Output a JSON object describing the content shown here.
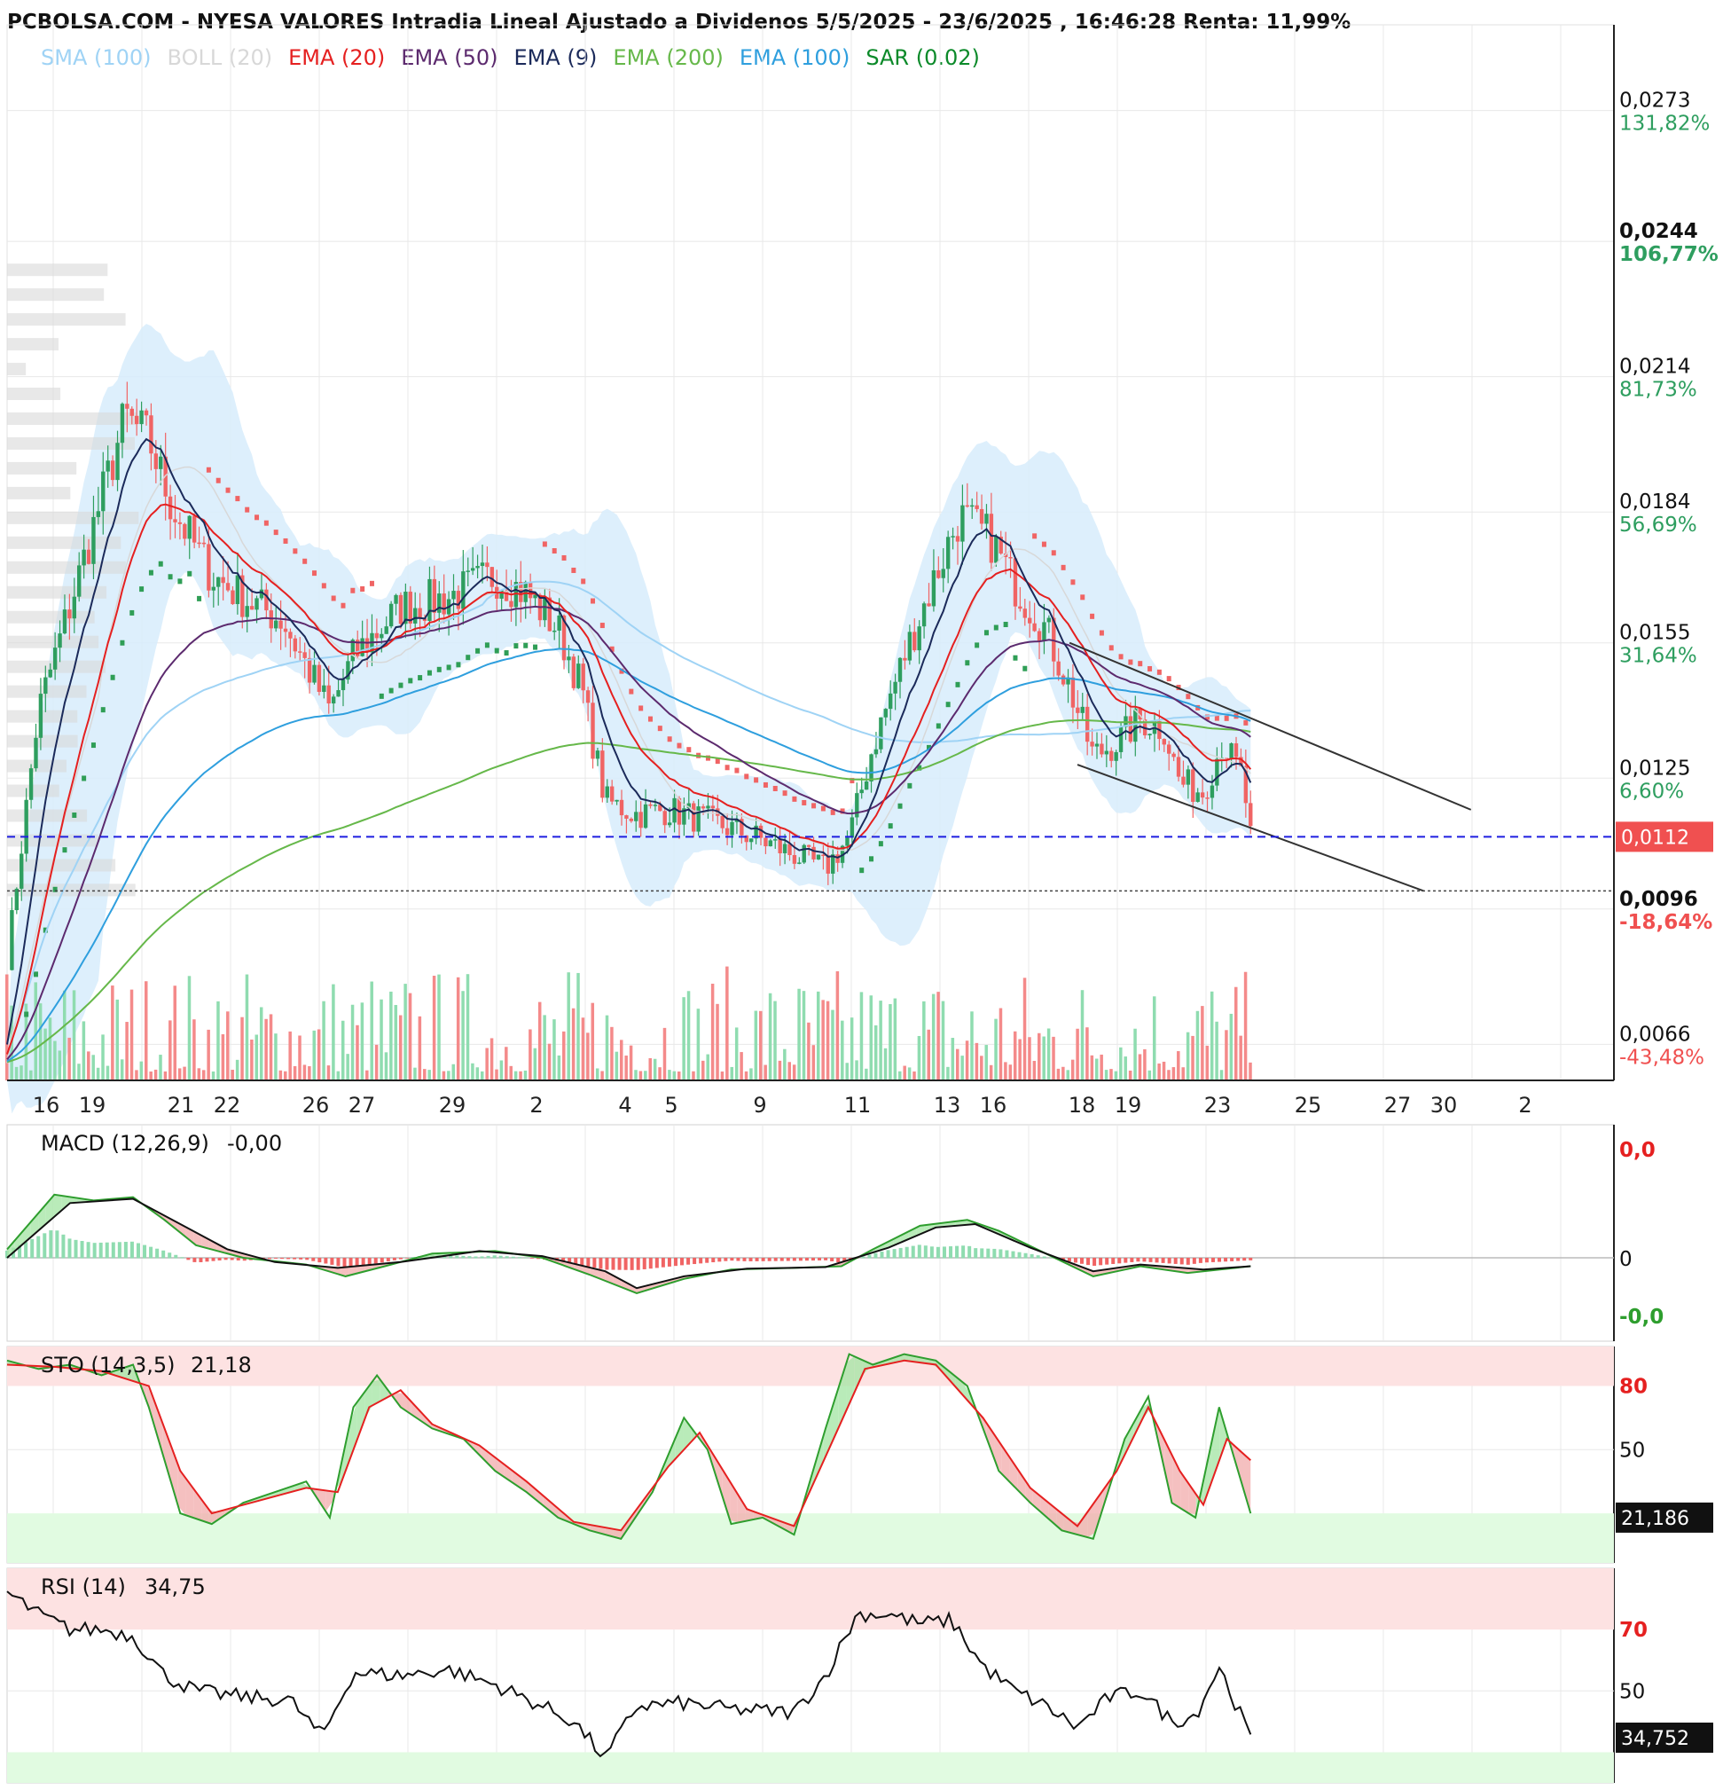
{
  "header": {
    "title": "PCBOLSA.COM - NYESA VALORES Intradia Lineal Ajustado a Dividenos 5/5/2025 - 23/6/2025 , 16:46:28 Renta: 11,99%"
  },
  "legend": [
    {
      "label": "SMA (100)",
      "color": "#9fd3f5"
    },
    {
      "label": "BOLL (20)",
      "color": "#d8d8d8"
    },
    {
      "label": "EMA (20)",
      "color": "#e52020"
    },
    {
      "label": "EMA (50)",
      "color": "#5c2a6e"
    },
    {
      "label": "EMA (9)",
      "color": "#1b2a5a"
    },
    {
      "label": "EMA (200)",
      "color": "#66b84a"
    },
    {
      "label": "EMA (100)",
      "color": "#2f9fde"
    },
    {
      "label": "SAR (0.02)",
      "color": "#0c8a2a"
    }
  ],
  "colors": {
    "up": "#2e9e5f",
    "down": "#f06464",
    "up_volume": "#8fdcb0",
    "down_volume": "#f48a8a",
    "sar_up": "#2f9e56",
    "sar_down": "#f06464",
    "band_fill": "#d7ecfb",
    "grid": "#e8e8e8",
    "price_tag": "#f05050",
    "current_line": "#1f1fe0",
    "pct_up": "#2e9e5f",
    "pct_down": "#f05050"
  },
  "chart_data": [
    {
      "type": "candlestick",
      "name": "price",
      "ylim": [
        0.0058,
        0.0292
      ],
      "current_price": "0,0112",
      "reference_price": 0.01,
      "y_ticks": [
        {
          "value": 0.0273,
          "label": "0,0273",
          "pct": "131,82%",
          "bold": false
        },
        {
          "value": 0.0244,
          "label": "0,0244",
          "pct": "106,77%",
          "bold": true
        },
        {
          "value": 0.0214,
          "label": "0,0214",
          "pct": "81,73%",
          "bold": false
        },
        {
          "value": 0.0184,
          "label": "0,0184",
          "pct": "56,69%",
          "bold": false
        },
        {
          "value": 0.0155,
          "label": "0,0155",
          "pct": "31,64%",
          "bold": false
        },
        {
          "value": 0.0125,
          "label": "0,0125",
          "pct": "6,60%",
          "bold": false
        },
        {
          "value": 0.0096,
          "label": "0,0096",
          "pct": "-18,64%",
          "bold": true
        },
        {
          "value": 0.0066,
          "label": "0,0066",
          "pct": "-43,48%",
          "bold": false
        }
      ],
      "x_labels": [
        "16",
        "19",
        "21",
        "22",
        "26",
        "27",
        "29",
        "2",
        "4",
        "5",
        "9",
        "11",
        "13",
        "16",
        "18",
        "19",
        "23",
        "25",
        "27",
        "30",
        "2"
      ],
      "trend_lines": [
        {
          "from": [
            0.675,
            0.0155
          ],
          "to": [
            0.93,
            0.0118
          ]
        },
        {
          "from": [
            0.68,
            0.0128
          ],
          "to": [
            0.9,
            0.01
          ]
        }
      ],
      "waypoints": [
        [
          0,
          0.0085
        ],
        [
          0.02,
          0.014
        ],
        [
          0.05,
          0.0175
        ],
        [
          0.075,
          0.0205
        ],
        [
          0.09,
          0.02
        ],
        [
          0.105,
          0.0185
        ],
        [
          0.13,
          0.017
        ],
        [
          0.15,
          0.0165
        ],
        [
          0.175,
          0.016
        ],
        [
          0.19,
          0.015
        ],
        [
          0.205,
          0.014
        ],
        [
          0.22,
          0.0152
        ],
        [
          0.25,
          0.0163
        ],
        [
          0.28,
          0.0165
        ],
        [
          0.31,
          0.017
        ],
        [
          0.33,
          0.0166
        ],
        [
          0.35,
          0.0158
        ],
        [
          0.365,
          0.0145
        ],
        [
          0.38,
          0.012
        ],
        [
          0.4,
          0.0117
        ],
        [
          0.42,
          0.0118
        ],
        [
          0.45,
          0.0115
        ],
        [
          0.475,
          0.0112
        ],
        [
          0.5,
          0.0108
        ],
        [
          0.52,
          0.0105
        ],
        [
          0.535,
          0.0112
        ],
        [
          0.55,
          0.0132
        ],
        [
          0.57,
          0.0152
        ],
        [
          0.59,
          0.017
        ],
        [
          0.605,
          0.0183
        ],
        [
          0.625,
          0.0178
        ],
        [
          0.64,
          0.0168
        ],
        [
          0.66,
          0.0158
        ],
        [
          0.675,
          0.0145
        ],
        [
          0.69,
          0.013
        ],
        [
          0.705,
          0.0133
        ],
        [
          0.72,
          0.0138
        ],
        [
          0.735,
          0.0136
        ],
        [
          0.745,
          0.0124
        ],
        [
          0.76,
          0.0122
        ],
        [
          0.772,
          0.0133
        ],
        [
          0.785,
          0.0125
        ],
        [
          0.79,
          0.0112
        ]
      ]
    },
    {
      "type": "line",
      "name": "MACD (12,26,9)",
      "value": "-0,00",
      "y_ticks": [
        {
          "label": "0,0",
          "color": "#e52020"
        },
        {
          "label": "0",
          "color": "#111111"
        },
        {
          "label": "-0,0",
          "color": "#2e9e2e"
        }
      ],
      "macd": [
        [
          0,
          0.1
        ],
        [
          0.03,
          0.75
        ],
        [
          0.055,
          0.68
        ],
        [
          0.08,
          0.72
        ],
        [
          0.1,
          0.45
        ],
        [
          0.12,
          0.15
        ],
        [
          0.15,
          0.0
        ],
        [
          0.19,
          -0.08
        ],
        [
          0.215,
          -0.22
        ],
        [
          0.24,
          -0.1
        ],
        [
          0.27,
          0.05
        ],
        [
          0.31,
          0.08
        ],
        [
          0.34,
          0.0
        ],
        [
          0.37,
          -0.2
        ],
        [
          0.4,
          -0.42
        ],
        [
          0.43,
          -0.25
        ],
        [
          0.46,
          -0.14
        ],
        [
          0.5,
          -0.12
        ],
        [
          0.53,
          -0.1
        ],
        [
          0.55,
          0.1
        ],
        [
          0.58,
          0.38
        ],
        [
          0.61,
          0.45
        ],
        [
          0.63,
          0.32
        ],
        [
          0.66,
          0.05
        ],
        [
          0.69,
          -0.22
        ],
        [
          0.72,
          -0.1
        ],
        [
          0.75,
          -0.18
        ],
        [
          0.79,
          -0.1
        ]
      ],
      "signal": [
        [
          0,
          0.0
        ],
        [
          0.04,
          0.65
        ],
        [
          0.08,
          0.7
        ],
        [
          0.11,
          0.4
        ],
        [
          0.14,
          0.1
        ],
        [
          0.17,
          -0.05
        ],
        [
          0.21,
          -0.12
        ],
        [
          0.25,
          -0.05
        ],
        [
          0.3,
          0.08
        ],
        [
          0.34,
          0.02
        ],
        [
          0.38,
          -0.16
        ],
        [
          0.4,
          -0.36
        ],
        [
          0.43,
          -0.22
        ],
        [
          0.47,
          -0.13
        ],
        [
          0.52,
          -0.11
        ],
        [
          0.56,
          0.12
        ],
        [
          0.59,
          0.36
        ],
        [
          0.615,
          0.4
        ],
        [
          0.65,
          0.12
        ],
        [
          0.69,
          -0.16
        ],
        [
          0.72,
          -0.08
        ],
        [
          0.76,
          -0.14
        ],
        [
          0.79,
          -0.1
        ]
      ]
    },
    {
      "type": "line",
      "name": "STO (14,3,5)",
      "value": "21,18",
      "current": "21,186",
      "ylim": [
        0,
        100
      ],
      "bands": {
        "upper": 80,
        "lower": 20
      },
      "y_ticks": [
        {
          "value": 80,
          "label": "80",
          "color": "#e52020"
        },
        {
          "value": 50,
          "label": "50",
          "color": "#111111"
        },
        {
          "value": 20,
          "label": "20",
          "color": "#2e9e2e"
        }
      ],
      "k": [
        [
          0,
          92
        ],
        [
          0.02,
          88
        ],
        [
          0.04,
          90
        ],
        [
          0.06,
          85
        ],
        [
          0.08,
          90
        ],
        [
          0.09,
          70
        ],
        [
          0.11,
          20
        ],
        [
          0.13,
          15
        ],
        [
          0.15,
          25
        ],
        [
          0.17,
          30
        ],
        [
          0.19,
          35
        ],
        [
          0.205,
          18
        ],
        [
          0.22,
          70
        ],
        [
          0.235,
          85
        ],
        [
          0.25,
          70
        ],
        [
          0.27,
          60
        ],
        [
          0.29,
          55
        ],
        [
          0.31,
          40
        ],
        [
          0.33,
          30
        ],
        [
          0.35,
          18
        ],
        [
          0.37,
          12
        ],
        [
          0.39,
          8
        ],
        [
          0.41,
          30
        ],
        [
          0.43,
          65
        ],
        [
          0.445,
          50
        ],
        [
          0.46,
          15
        ],
        [
          0.48,
          18
        ],
        [
          0.5,
          10
        ],
        [
          0.52,
          60
        ],
        [
          0.535,
          95
        ],
        [
          0.55,
          90
        ],
        [
          0.57,
          95
        ],
        [
          0.59,
          92
        ],
        [
          0.61,
          80
        ],
        [
          0.63,
          40
        ],
        [
          0.65,
          25
        ],
        [
          0.67,
          12
        ],
        [
          0.69,
          8
        ],
        [
          0.71,
          55
        ],
        [
          0.725,
          75
        ],
        [
          0.74,
          25
        ],
        [
          0.755,
          18
        ],
        [
          0.77,
          70
        ],
        [
          0.79,
          20
        ]
      ],
      "d": [
        [
          0,
          90
        ],
        [
          0.03,
          89
        ],
        [
          0.06,
          87
        ],
        [
          0.09,
          80
        ],
        [
          0.11,
          40
        ],
        [
          0.13,
          20
        ],
        [
          0.16,
          26
        ],
        [
          0.19,
          32
        ],
        [
          0.21,
          30
        ],
        [
          0.23,
          70
        ],
        [
          0.25,
          78
        ],
        [
          0.27,
          62
        ],
        [
          0.3,
          52
        ],
        [
          0.33,
          35
        ],
        [
          0.36,
          16
        ],
        [
          0.39,
          12
        ],
        [
          0.42,
          42
        ],
        [
          0.44,
          58
        ],
        [
          0.47,
          22
        ],
        [
          0.5,
          14
        ],
        [
          0.525,
          55
        ],
        [
          0.545,
          88
        ],
        [
          0.57,
          92
        ],
        [
          0.59,
          90
        ],
        [
          0.62,
          65
        ],
        [
          0.65,
          32
        ],
        [
          0.68,
          14
        ],
        [
          0.705,
          40
        ],
        [
          0.725,
          70
        ],
        [
          0.745,
          40
        ],
        [
          0.76,
          24
        ],
        [
          0.775,
          55
        ],
        [
          0.79,
          45
        ]
      ]
    },
    {
      "type": "line",
      "name": "RSI (14)",
      "value": "34,75",
      "current": "34,752",
      "ylim": [
        20,
        90
      ],
      "bands": {
        "upper": 70,
        "lower": 30
      },
      "y_ticks": [
        {
          "value": 70,
          "label": "70",
          "color": "#e52020"
        },
        {
          "value": 50,
          "label": "50",
          "color": "#111111"
        }
      ],
      "values": [
        [
          0,
          82
        ],
        [
          0.02,
          75
        ],
        [
          0.04,
          70
        ],
        [
          0.06,
          70
        ],
        [
          0.08,
          68
        ],
        [
          0.1,
          55
        ],
        [
          0.12,
          50
        ],
        [
          0.15,
          48
        ],
        [
          0.18,
          47
        ],
        [
          0.2,
          35
        ],
        [
          0.22,
          56
        ],
        [
          0.25,
          55
        ],
        [
          0.28,
          57
        ],
        [
          0.31,
          52
        ],
        [
          0.34,
          45
        ],
        [
          0.36,
          40
        ],
        [
          0.38,
          28
        ],
        [
          0.4,
          45
        ],
        [
          0.43,
          46
        ],
        [
          0.46,
          44
        ],
        [
          0.5,
          43
        ],
        [
          0.52,
          55
        ],
        [
          0.54,
          75
        ],
        [
          0.56,
          75
        ],
        [
          0.58,
          72
        ],
        [
          0.6,
          73
        ],
        [
          0.62,
          58
        ],
        [
          0.64,
          50
        ],
        [
          0.66,
          45
        ],
        [
          0.68,
          38
        ],
        [
          0.7,
          48
        ],
        [
          0.72,
          50
        ],
        [
          0.74,
          40
        ],
        [
          0.755,
          42
        ],
        [
          0.77,
          58
        ],
        [
          0.79,
          34.75
        ]
      ]
    }
  ]
}
